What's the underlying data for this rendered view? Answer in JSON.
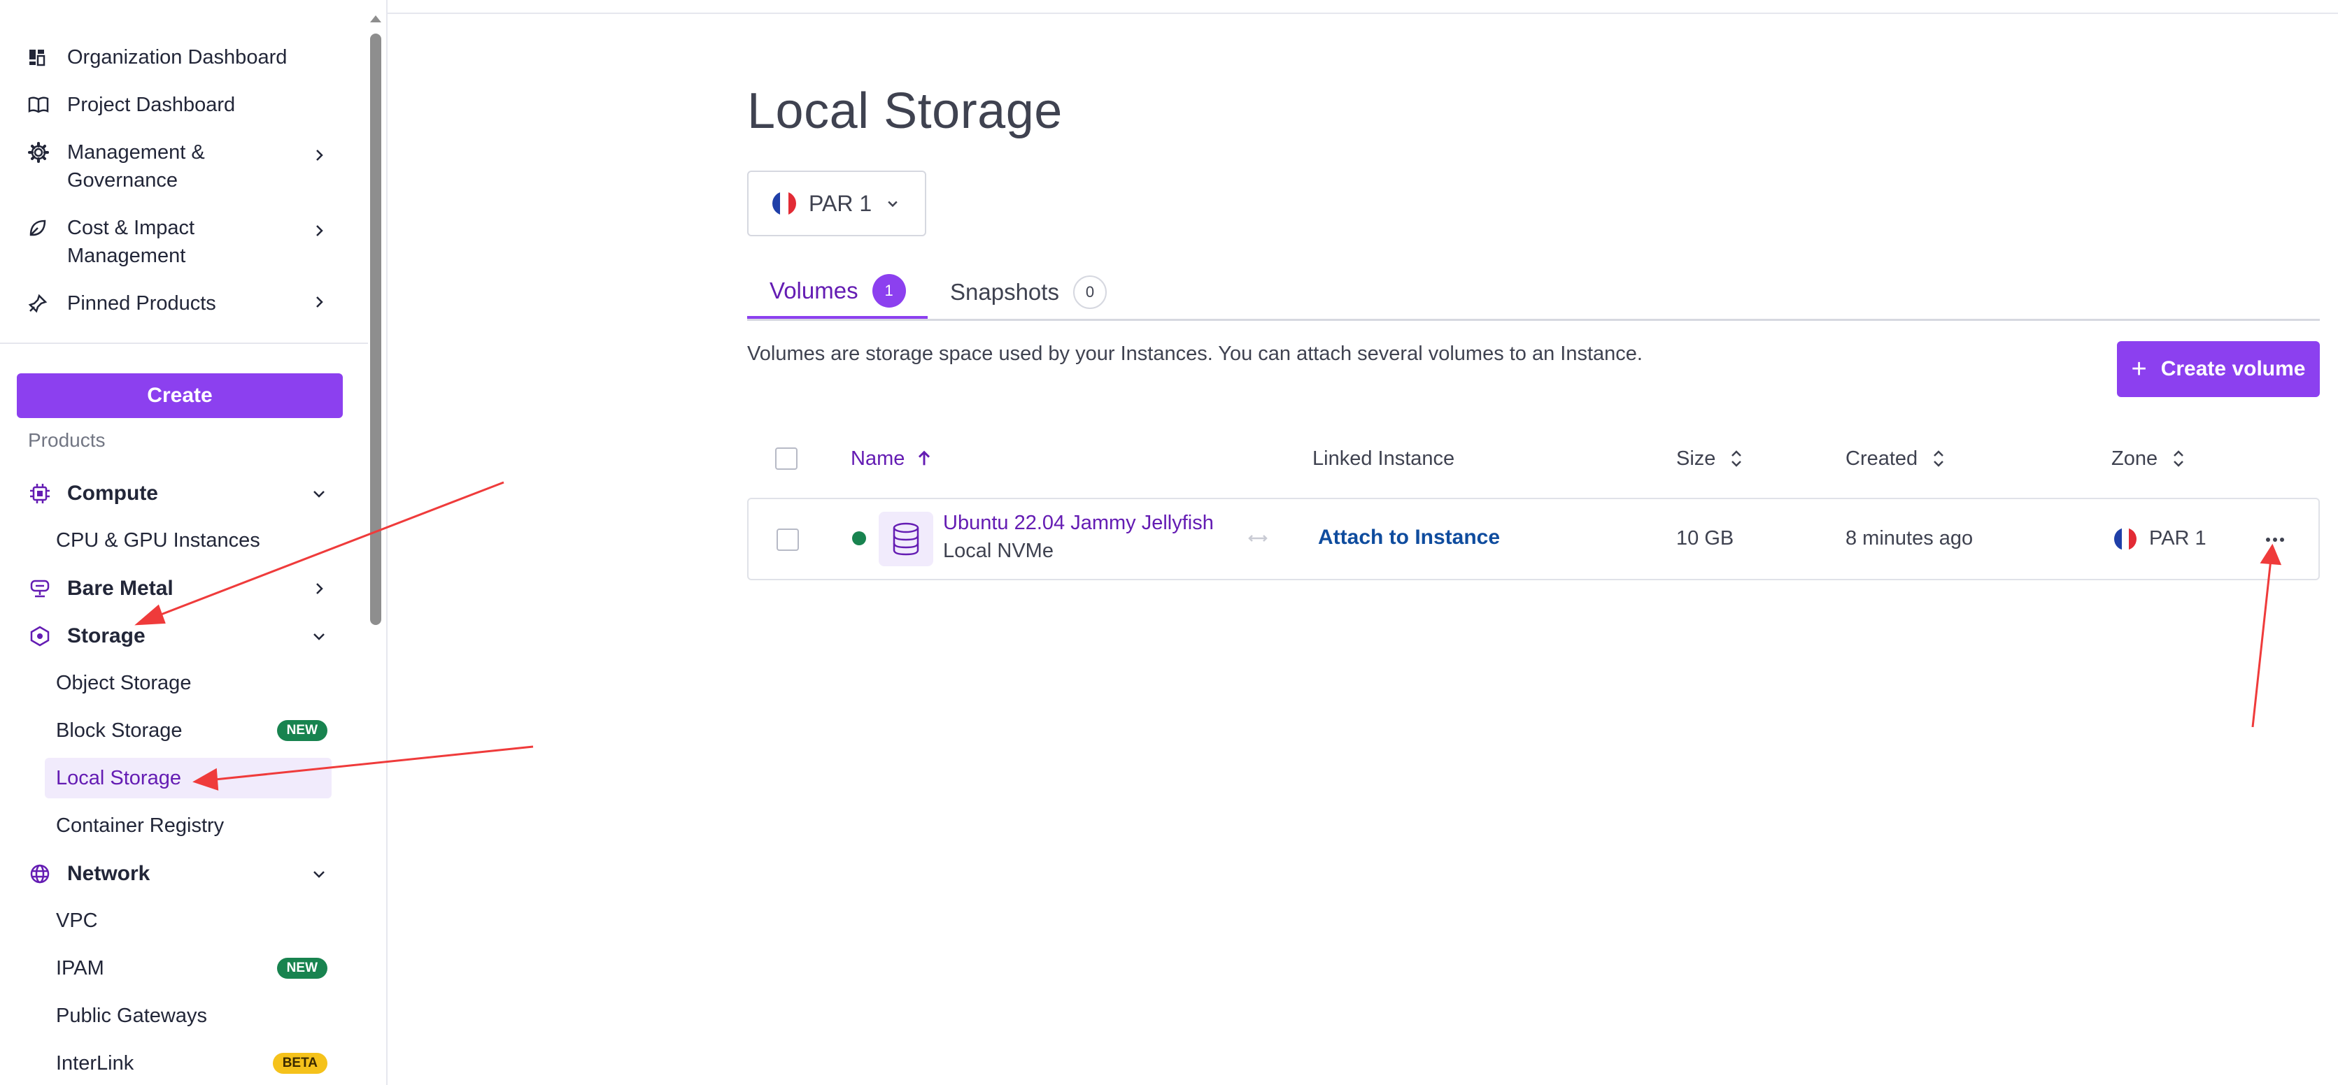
{
  "sidebar": {
    "nav": [
      {
        "label": "Organization Dashboard",
        "icon": "dashboard-icon"
      },
      {
        "label": "Project Dashboard",
        "icon": "book-icon"
      },
      {
        "label_line1": "Management &",
        "label_line2": "Governance",
        "icon": "gear-icon"
      },
      {
        "label_line1": "Cost & Impact",
        "label_line2": "Management",
        "icon": "leaf-icon"
      },
      {
        "label": "Pinned Products",
        "icon": "pin-icon"
      }
    ],
    "create_label": "Create",
    "products_label": "Products",
    "categories": {
      "compute": "Compute",
      "bare_metal": "Bare Metal",
      "storage": "Storage",
      "network": "Network"
    },
    "compute_items": [
      "CPU & GPU Instances"
    ],
    "storage_items": [
      {
        "label": "Object Storage"
      },
      {
        "label": "Block Storage",
        "badge": "NEW"
      },
      {
        "label": "Local Storage"
      },
      {
        "label": "Container Registry"
      }
    ],
    "network_items": [
      {
        "label": "VPC"
      },
      {
        "label": "IPAM",
        "badge": "NEW"
      },
      {
        "label": "Public Gateways"
      },
      {
        "label": "InterLink",
        "badge": "BETA"
      }
    ]
  },
  "main": {
    "title": "Local Storage",
    "zone_select": "PAR 1",
    "tabs": [
      {
        "label": "Volumes",
        "count": "1"
      },
      {
        "label": "Snapshots",
        "count": "0"
      }
    ],
    "description": "Volumes are storage space used by your Instances. You can attach several volumes to an Instance.",
    "create_volume_label": "Create volume",
    "table": {
      "headers": {
        "name": "Name",
        "linked_instance": "Linked Instance",
        "size": "Size",
        "created": "Created",
        "zone": "Zone"
      },
      "rows": [
        {
          "name": "Ubuntu 22.04 Jammy Jellyfish",
          "type": "Local NVMe",
          "linked_action": "Attach to Instance",
          "size": "10 GB",
          "created": "8 minutes ago",
          "zone": "PAR 1",
          "status": "active"
        }
      ]
    }
  },
  "colors": {
    "accent": "#8c40ef",
    "accent_text": "#641cb3",
    "success": "#18834f",
    "link": "#0f4c9e",
    "annotation_arrow": "#ef3b3b"
  }
}
